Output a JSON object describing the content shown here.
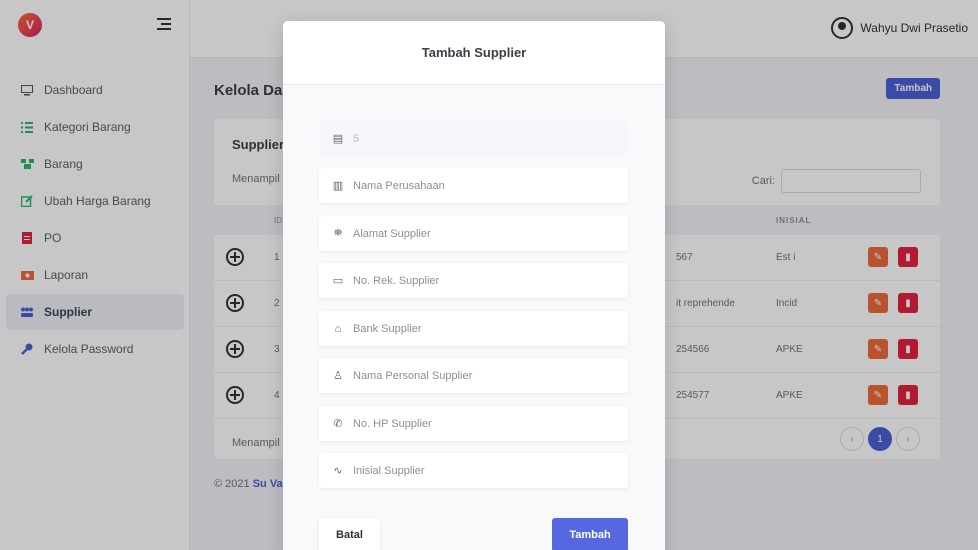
{
  "sidebar": {
    "logo_letter": "V",
    "items": [
      {
        "label": "Dashboard",
        "icon": "monitor-icon",
        "color": "#555"
      },
      {
        "label": "Kategori Barang",
        "icon": "list-icon",
        "color": "#2bb673"
      },
      {
        "label": "Barang",
        "icon": "boxes-icon",
        "color": "#2bb673"
      },
      {
        "label": "Ubah Harga Barang",
        "icon": "edit-icon",
        "color": "#2bb673"
      },
      {
        "label": "PO",
        "icon": "file-icon",
        "color": "#e3233f"
      },
      {
        "label": "Laporan",
        "icon": "report-icon",
        "color": "#ed6b3a"
      },
      {
        "label": "Supplier",
        "icon": "users-icon",
        "color": "#4e5fd6"
      },
      {
        "label": "Kelola Password",
        "icon": "key-icon",
        "color": "#4e5fd6"
      }
    ]
  },
  "topbar": {
    "username": "Wahyu Dwi Prasetio"
  },
  "main": {
    "page_title": "Kelola Da",
    "add_button": "Tambah",
    "card_title": "Supplier",
    "showing_top": "Menampil",
    "search_label": "Cari:",
    "col_id": "ID",
    "col_inisial": "INISIAL",
    "rows": [
      {
        "id": "1",
        "text": "567",
        "inisial": "Est i"
      },
      {
        "id": "2",
        "text": "it reprehende",
        "inisial": "Incid"
      },
      {
        "id": "3",
        "text": "254566",
        "inisial": "APKE"
      },
      {
        "id": "4",
        "text": "254577",
        "inisial": "APKE"
      }
    ],
    "showing_bottom": "Menampil",
    "pager": {
      "prev": "‹",
      "current": "1",
      "next": "›"
    },
    "footer_text": "© 2021",
    "footer_link": "Su Va"
  },
  "modal": {
    "title": "Tambah Supplier",
    "id_value": "5",
    "fields": [
      {
        "placeholder": "Nama Perusahaan",
        "icon": "building-icon"
      },
      {
        "placeholder": "Alamat Supplier",
        "icon": "map-icon"
      },
      {
        "placeholder": "No. Rek. Supplier",
        "icon": "card-icon"
      },
      {
        "placeholder": "Bank Supplier",
        "icon": "bank-icon"
      },
      {
        "placeholder": "Nama Personal Supplier",
        "icon": "person-icon"
      },
      {
        "placeholder": "No. HP Supplier",
        "icon": "phone-icon"
      },
      {
        "placeholder": "Inisial Supplier",
        "icon": "signature-icon"
      }
    ],
    "cancel_label": "Batal",
    "submit_label": "Tambah"
  }
}
